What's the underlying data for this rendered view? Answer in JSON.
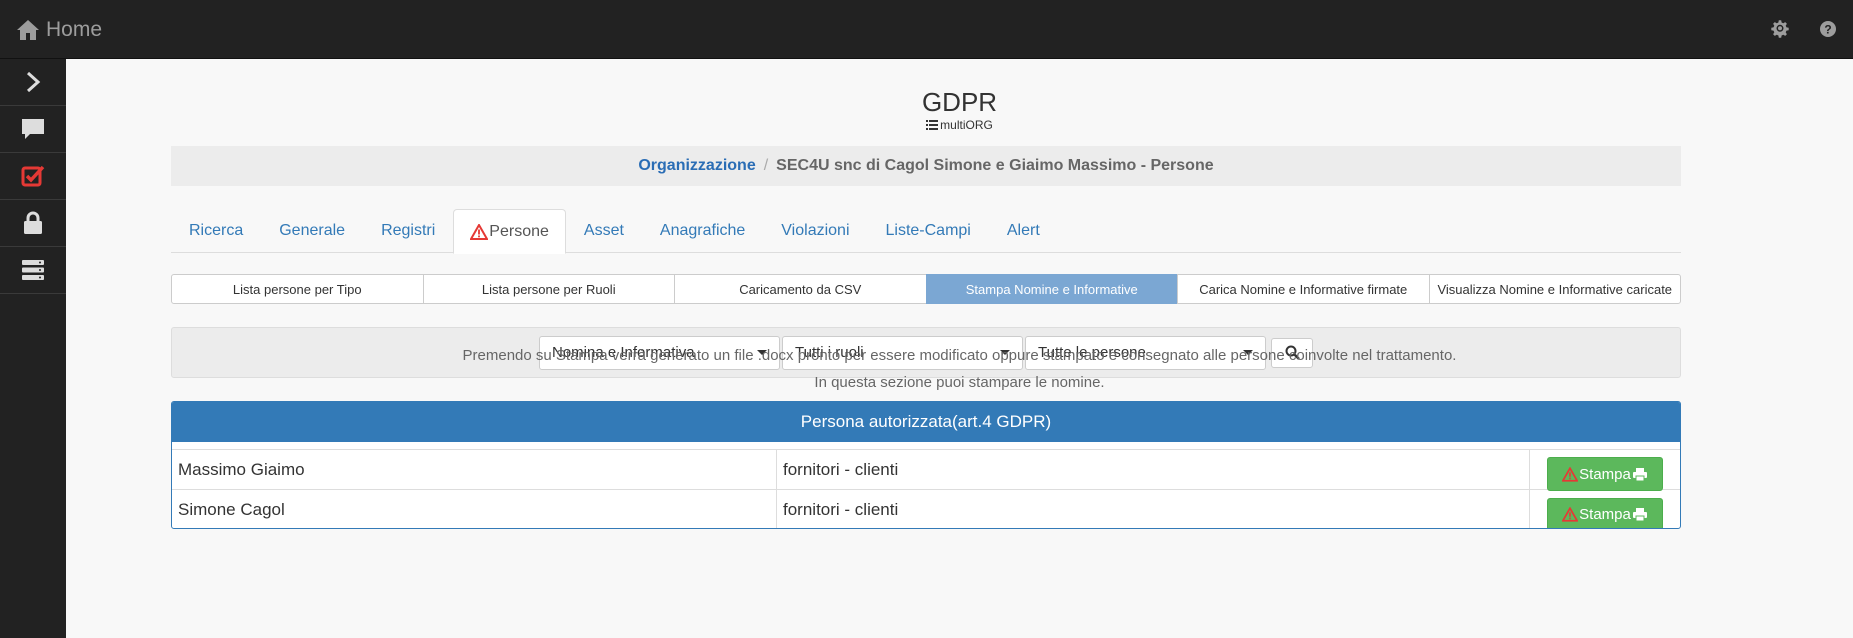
{
  "topbar": {
    "home_label": "Home",
    "icons": [
      "home-icon",
      "gear-icon",
      "help-icon"
    ]
  },
  "sidebar": {
    "items": [
      {
        "name": "chevron-right-icon"
      },
      {
        "name": "chat-icon"
      },
      {
        "name": "checkbox-icon",
        "color": "#e53935"
      },
      {
        "name": "lock-icon"
      },
      {
        "name": "server-icon"
      }
    ]
  },
  "header": {
    "title": "GDPR",
    "subtitle": "multiORG"
  },
  "breadcrumb": {
    "link": "Organizzazione",
    "separator": "/",
    "current": "SEC4U snc di Cagol Simone e Giaimo Massimo - Persone"
  },
  "tabs": [
    {
      "label": "Ricerca",
      "active": false
    },
    {
      "label": "Generale",
      "active": false
    },
    {
      "label": "Registri",
      "active": false
    },
    {
      "label": "Persone",
      "active": true,
      "icon": "warning-icon"
    },
    {
      "label": "Asset",
      "active": false
    },
    {
      "label": "Anagrafiche",
      "active": false
    },
    {
      "label": "Violazioni",
      "active": false
    },
    {
      "label": "Liste-Campi",
      "active": false
    },
    {
      "label": "Alert",
      "active": false
    }
  ],
  "subtabs": [
    {
      "label": "Lista persone per Tipo",
      "active": false
    },
    {
      "label": "Lista persone per Ruoli",
      "active": false
    },
    {
      "label": "Caricamento da CSV",
      "active": false
    },
    {
      "label": "Stampa Nomine e Informative",
      "active": true
    },
    {
      "label": "Carica Nomine e Informative firmate",
      "active": false
    },
    {
      "label": "Visualizza Nomine e Informative caricate",
      "active": false
    }
  ],
  "filters": {
    "document_type": "Nomina e Informativa",
    "role": "Tutti i ruoli",
    "person": "Tutte le persone"
  },
  "info": {
    "line1": "Premendo su Stampa verrà generato un file .docx pronto per essere modificato oppure stampato e consegnato alle persone coinvolte nel trattamento.",
    "line2": "In questa sezione puoi stampare le nomine."
  },
  "panel": {
    "title": "Persona autorizzata(art.4 GDPR)",
    "print_label": "Stampa",
    "rows": [
      {
        "name": "Massimo Giaimo",
        "role": "fornitori - clienti"
      },
      {
        "name": "Simone Cagol",
        "role": "fornitori - clienti"
      }
    ]
  },
  "colors": {
    "topbar": "#222222",
    "accent": "#337ab7",
    "active_subtab": "#7ba7d3",
    "print_button": "#5cb85c",
    "warning": "#e53935"
  }
}
